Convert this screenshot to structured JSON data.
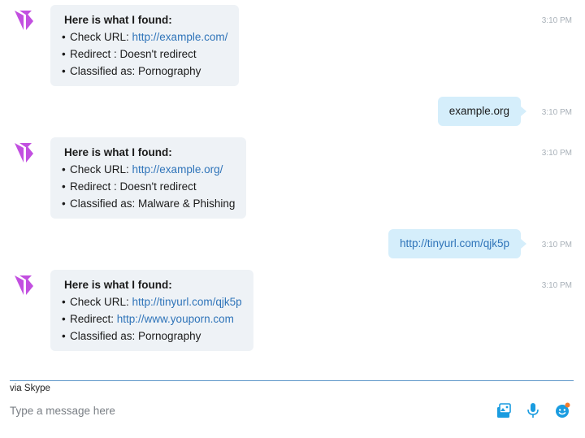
{
  "colors": {
    "accent": "#2f74b9",
    "incoming_bubble": "#eef2f6",
    "outgoing_bubble": "#d5eefb",
    "bot_avatar": "#c24fe0",
    "icon_blue": "#1a9ce0",
    "notify_dot": "#f47b2a"
  },
  "messages": [
    {
      "direction": "incoming",
      "title": "Here is what I found:",
      "lines": [
        {
          "label": "Check URL: ",
          "value": "http://example.com/",
          "value_is_link": true
        },
        {
          "label": "Redirect : Doesn't redirect",
          "value": "",
          "value_is_link": false
        },
        {
          "label": "Classified as: Pornography",
          "value": "",
          "value_is_link": false
        }
      ],
      "time": "3:10 PM"
    },
    {
      "direction": "outgoing",
      "text": "example.org",
      "time": "3:10 PM"
    },
    {
      "direction": "incoming",
      "title": "Here is what I found:",
      "lines": [
        {
          "label": "Check URL: ",
          "value": "http://example.org/",
          "value_is_link": true
        },
        {
          "label": "Redirect : Doesn't redirect",
          "value": "",
          "value_is_link": false
        },
        {
          "label": "Classified as: Malware & Phishing",
          "value": "",
          "value_is_link": false
        }
      ],
      "time": "3:10 PM"
    },
    {
      "direction": "outgoing",
      "text": "http://tinyurl.com/qjk5p",
      "time": "3:10 PM"
    },
    {
      "direction": "incoming",
      "title": "Here is what I found:",
      "lines": [
        {
          "label": "Check URL: ",
          "value": "http://tinyurl.com/qjk5p",
          "value_is_link": true
        },
        {
          "label": "Redirect: ",
          "value": "http://www.youporn.com",
          "value_is_link": true
        },
        {
          "label": "Classified as: Pornography",
          "value": "",
          "value_is_link": false
        }
      ],
      "time": "3:10 PM"
    }
  ],
  "footer": {
    "via_label": "via Skype",
    "composer_placeholder": "Type a message here",
    "icons": [
      "media-gallery-icon",
      "microphone-icon",
      "emoji-icon"
    ]
  }
}
